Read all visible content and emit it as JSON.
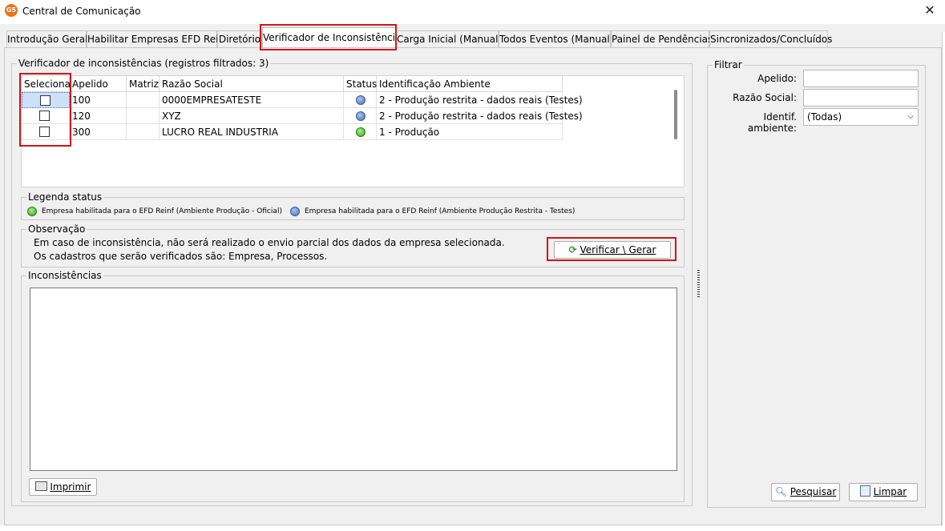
{
  "window": {
    "title": "Central de Comunicação",
    "icon_text": "G5",
    "icon_name": "app-logo-icon",
    "close_glyph": "✕"
  },
  "tabs": [
    {
      "label": "Introdução Geral"
    },
    {
      "label": "Habilitar Empresas EFD Reinf"
    },
    {
      "label": "Diretório"
    },
    {
      "label": "Verificador de Inconsistências",
      "active": true
    },
    {
      "label": "Carga Inicial (Manual)"
    },
    {
      "label": "Todos Eventos (Manual)"
    },
    {
      "label": "Painel de Pendências"
    },
    {
      "label": "Sincronizados/Concluídos"
    }
  ],
  "main_group": {
    "legend": "Verificador de inconsistências (registros filtrados: 3)"
  },
  "grid": {
    "columns": [
      "Selecionar",
      "Apelido",
      "Matriz",
      "Razão Social",
      "Status",
      "Identificação Ambiente"
    ],
    "rows": [
      {
        "selected": false,
        "apelido": "100",
        "matriz": "",
        "razao": "0000EMPRESATESTE",
        "status": "blue",
        "ambiente": "2 - Produção restrita - dados reais (Testes)"
      },
      {
        "selected": false,
        "apelido": "120",
        "matriz": "",
        "razao": "XYZ",
        "status": "blue",
        "ambiente": "2 - Produção restrita - dados reais (Testes)"
      },
      {
        "selected": false,
        "apelido": "300",
        "matriz": "",
        "razao": "LUCRO REAL INDUSTRIA",
        "status": "green",
        "ambiente": "1 - Produção"
      }
    ]
  },
  "legend_group": {
    "legend": "Legenda status",
    "items": [
      {
        "color": "green",
        "text": "Empresa habilitada para o EFD Reinf (Ambiente Produção - Oficial)"
      },
      {
        "color": "blue",
        "text": "Empresa habilitada para o EFD Reinf (Ambiente Produção Restrita - Testes)"
      }
    ]
  },
  "observacao": {
    "legend": "Observação",
    "line1": "Em caso de inconsistência, não será realizado o envio parcial dos dados da empresa selecionada.",
    "line2": "Os cadastros que serão verificados são: Empresa, Processos.",
    "button_label": "Verificar \\ Gerar",
    "button_icon": "refresh-icon"
  },
  "inconsistencias": {
    "legend": "Inconsistências",
    "print_button": "Imprimir",
    "print_icon": "printer-icon"
  },
  "filtrar": {
    "legend": "Filtrar",
    "apelido_label": "Apelido:",
    "apelido_value": "",
    "razao_label": "Razão Social:",
    "razao_value": "",
    "ambiente_label": "Identif. ambiente:",
    "ambiente_value": "(Todas)",
    "pesquisar": "Pesquisar",
    "limpar": "Limpar"
  },
  "colors": {
    "highlight": "#d2131a",
    "window_bg": "#f0f0f0"
  }
}
